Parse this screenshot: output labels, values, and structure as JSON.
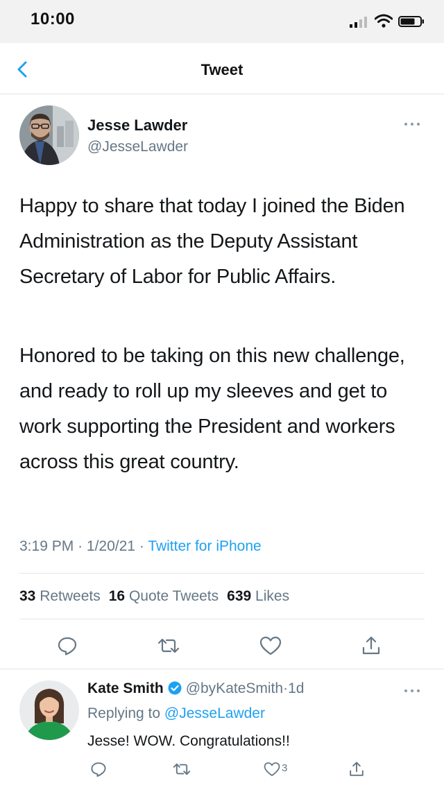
{
  "status_bar": {
    "time": "10:00"
  },
  "nav": {
    "title": "Tweet"
  },
  "tweet": {
    "author_name": "Jesse Lawder",
    "author_handle": "@JesseLawder",
    "paragraph_1": "Happy to share that today I joined the Biden Administration as the Deputy Assistant Secretary of Labor for Public Affairs.",
    "paragraph_2": "Honored to be taking on this new challenge, and ready to roll up my sleeves and get to work supporting the President and workers across this great country.",
    "time": "3:19 PM",
    "date": "1/20/21",
    "source": "Twitter for iPhone",
    "separator": "·",
    "retweets_count": "33",
    "retweets_label": "Retweets",
    "quote_count": "16",
    "quote_label": "Quote Tweets",
    "likes_count": "639",
    "likes_label": "Likes"
  },
  "reply": {
    "name": "Kate Smith",
    "handle": "@byKateSmith",
    "age": "1d",
    "replying_prefix": "Replying to",
    "replying_to": "@JesseLawder",
    "text": "Jesse! WOW. Congratulations!!",
    "like_count": "3"
  },
  "colors": {
    "accent": "#1da1f2",
    "secondary_text": "#657786",
    "primary_text": "#14171a"
  },
  "icons": {
    "back": "chevron-left-icon",
    "more": "more-horizontal-icon",
    "reply": "reply-icon",
    "retweet": "retweet-icon",
    "like": "heart-icon",
    "share": "share-icon",
    "verified": "verified-badge-icon"
  }
}
